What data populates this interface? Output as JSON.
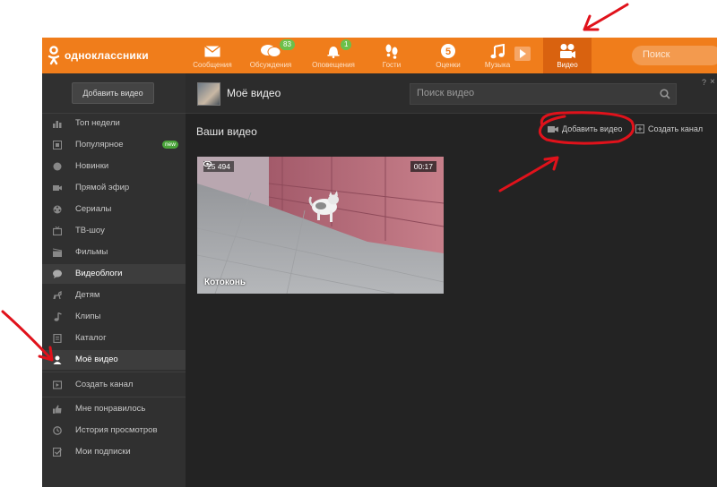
{
  "brand": {
    "name": "одноклассники",
    "color": "#f07d1b"
  },
  "topnav": [
    {
      "label": "Сообщения",
      "icon": "envelope-icon"
    },
    {
      "label": "Обсуждения",
      "icon": "chat-bubbles-icon",
      "badge": "83"
    },
    {
      "label": "Оповещения",
      "icon": "bell-icon",
      "badge": "1"
    },
    {
      "label": "Гости",
      "icon": "footprints-icon"
    },
    {
      "label": "Оценки",
      "icon": "rating-icon"
    },
    {
      "label": "Музыка",
      "icon": "music-note-icon"
    },
    {
      "label": "Видео",
      "icon": "video-camera-icon",
      "active": true
    }
  ],
  "top_search": {
    "placeholder": "Поиск"
  },
  "sidebar": {
    "add_video_label": "Добавить видео",
    "items": [
      {
        "label": "Топ недели",
        "icon": "bar-chart-icon"
      },
      {
        "label": "Популярное",
        "icon": "film-icon",
        "badge": "new"
      },
      {
        "label": "Новинки",
        "icon": "circle-icon"
      },
      {
        "label": "Прямой эфир",
        "icon": "camera-icon"
      },
      {
        "label": "Сериалы",
        "icon": "reel-icon"
      },
      {
        "label": "ТВ-шоу",
        "icon": "tv-icon"
      },
      {
        "label": "Фильмы",
        "icon": "clapperboard-icon"
      },
      {
        "label": "Видеоблоги",
        "icon": "speech-bubble-icon"
      },
      {
        "label": "Детям",
        "icon": "horse-icon"
      },
      {
        "label": "Клипы",
        "icon": "music-note-icon"
      },
      {
        "label": "Каталог",
        "icon": "catalog-icon"
      },
      {
        "label": "Моё видео",
        "icon": "user-icon",
        "active": true
      }
    ],
    "create_channel_label": "Создать канал",
    "bottom_items": [
      {
        "label": "Мне понравилось",
        "icon": "thumbs-up-icon"
      },
      {
        "label": "История просмотров",
        "icon": "history-icon"
      },
      {
        "label": "Мои подписки",
        "icon": "subscriptions-icon"
      }
    ]
  },
  "main": {
    "title": "Моё видео",
    "search_placeholder": "Поиск видео",
    "help_label": "?",
    "close_label": "×",
    "section_title": "Ваши видео",
    "add_video_label": "Добавить видео",
    "create_channel_label": "Создать канал",
    "videos": [
      {
        "title": "Котоконь",
        "views": "25 494",
        "duration": "00:17"
      }
    ]
  },
  "annotation_color": "#e0121b"
}
